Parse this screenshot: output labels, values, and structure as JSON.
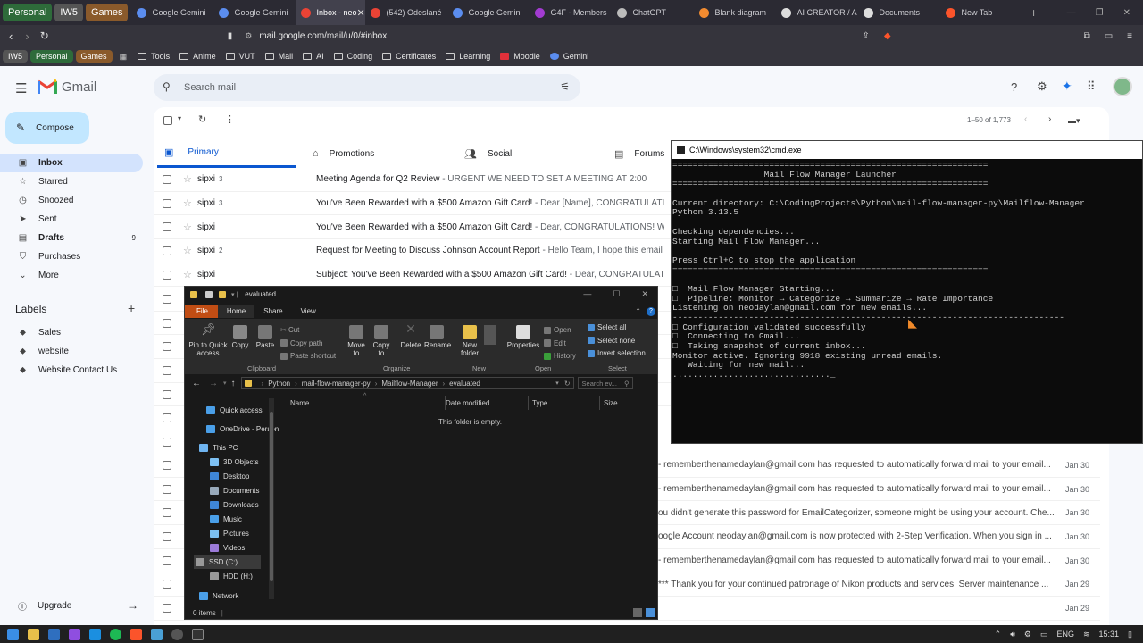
{
  "browser": {
    "tab_groups": [
      "Personal",
      "IW5",
      "Games"
    ],
    "tabs": [
      {
        "label": "Google Gemini",
        "color": "#5b8def"
      },
      {
        "label": "Google Gemini",
        "color": "#5b8def"
      },
      {
        "label": "Inbox - neo",
        "color": "#ea4335",
        "active": true
      },
      {
        "label": "(542) Odeslané",
        "color": "#ea4335"
      },
      {
        "label": "Google Gemini",
        "color": "#5b8def"
      },
      {
        "label": "G4F - Members",
        "color": "#a23bd1"
      },
      {
        "label": "ChatGPT",
        "color": "#bbbbbb"
      },
      {
        "label": "Blank diagram",
        "color": "#f28b30"
      },
      {
        "label": "AI CREATOR / A",
        "color": "#dddddd"
      },
      {
        "label": "Documents",
        "color": "#dddddd"
      },
      {
        "label": "New Tab",
        "color": "#fb542b"
      }
    ],
    "url": "mail.google.com/mail/u/0/#inbox",
    "bookmarks": {
      "groups": [
        "IW5",
        "Personal",
        "Games"
      ],
      "items": [
        "Tools",
        "Anime",
        "VUT",
        "Mail",
        "AI",
        "Coding",
        "Certificates",
        "Learning",
        "Moodle",
        "Gemini"
      ]
    }
  },
  "gmail": {
    "logo": "Gmail",
    "search_placeholder": "Search mail",
    "compose": "Compose",
    "nav": [
      {
        "label": "Inbox",
        "icon": "inbox-icon",
        "active": true,
        "bold": true,
        "count": ""
      },
      {
        "label": "Starred",
        "icon": "star-icon",
        "count": ""
      },
      {
        "label": "Snoozed",
        "icon": "clock-icon",
        "count": ""
      },
      {
        "label": "Sent",
        "icon": "send-icon",
        "count": ""
      },
      {
        "label": "Drafts",
        "icon": "draft-icon",
        "bold": true,
        "count": "9"
      },
      {
        "label": "Purchases",
        "icon": "purchases-icon",
        "count": ""
      },
      {
        "label": "More",
        "icon": "chevron-down-icon",
        "count": ""
      }
    ],
    "labels_title": "Labels",
    "labels": [
      "Sales",
      "website",
      "Website Contact Us"
    ],
    "upgrade": "Upgrade",
    "pagination": "1–50 of 1,773",
    "tabs": [
      "Primary",
      "Promotions",
      "Social",
      "Forums"
    ],
    "emails": [
      {
        "sender": "sipxi",
        "count": "3",
        "subject": "Meeting Agenda for Q2 Review",
        "preview": " - URGENT WE NEED TO SET A MEETING AT 2:00",
        "date": ""
      },
      {
        "sender": "sipxi",
        "count": "3",
        "subject": "You've Been Rewarded with a $500 Amazon Gift Card!",
        "preview": " - Dear [Name], CONGRATULATIONS! W",
        "date": ""
      },
      {
        "sender": "sipxi",
        "count": "",
        "subject": "You've Been Rewarded with a $500 Amazon Gift Card!",
        "preview": " - Dear, CONGRATULATIONS! We are th",
        "date": ""
      },
      {
        "sender": "sipxi",
        "count": "2",
        "subject": "Request for Meeting to Discuss Johnson Account Report",
        "preview": " - Hello Team, I hope this email finds y",
        "date": ""
      },
      {
        "sender": "sipxi",
        "count": "",
        "subject": "Subject: You've Been Rewarded with a $500 Amazon Gift Card!",
        "preview": " - Dear, CONGRATULATIONS! W",
        "date": ""
      }
    ],
    "lower_previews": [
      {
        "text": "- rememberthenamedaylan@gmail.com has requested to automatically forward mail to your email...",
        "date": "Jan 30"
      },
      {
        "text": "- rememberthenamedaylan@gmail.com has requested to automatically forward mail to your email...",
        "date": "Jan 30"
      },
      {
        "text": "ou didn't generate this password for EmailCategorizer, someone might be using your account. Che...",
        "date": "Jan 30"
      },
      {
        "text": "oogle Account neodaylan@gmail.com is now protected with 2-Step Verification. When you sign in ...",
        "date": "Jan 30"
      },
      {
        "text": "- rememberthenamedaylan@gmail.com has requested to automatically forward mail to your email...",
        "date": "Jan 30"
      },
      {
        "text": "*** Thank you for your continued patronage of Nikon products and services. Server maintenance ...",
        "date": "Jan 29"
      },
      {
        "text": "",
        "date": "Jan 29"
      }
    ]
  },
  "cmd": {
    "title": "C:\\Windows\\system32\\cmd.exe",
    "lines": [
      "==============================================================",
      "                  Mail Flow Manager Launcher",
      "==============================================================",
      "",
      "Current directory: C:\\CodingProjects\\Python\\mail-flow-manager-py\\Mailflow-Manager",
      "Python 3.13.5",
      "",
      "Checking dependencies...",
      "Starting Mail Flow Manager...",
      "",
      "Press Ctrl+C to stop the application",
      "==============================================================",
      "",
      "□  Mail Flow Manager Starting...",
      "□  Pipeline: Monitor → Categorize → Summarize → Rate Importance",
      "Listening on neodaylan@gmail.com for new emails...",
      "-----------------------------------------------------------------------------",
      "□ Configuration validated successfully",
      "□  Connecting to Gmail...",
      "□  Taking snapshot of current inbox...",
      "Monitor active. Ignoring 9918 existing unread emails.",
      "   Waiting for new mail...",
      "..............................._"
    ]
  },
  "explorer": {
    "title": "evaluated",
    "menu": [
      "File",
      "Home",
      "Share",
      "View"
    ],
    "ribbon": {
      "pin": "Pin to Quick access",
      "copy": "Copy",
      "paste": "Paste",
      "cut": "Cut",
      "copy_path": "Copy path",
      "paste_shortcut": "Paste shortcut",
      "move_to": "Move to",
      "copy_to": "Copy to",
      "delete": "Delete",
      "rename": "Rename",
      "new_folder": "New folder",
      "properties": "Properties",
      "open": "Open",
      "edit": "Edit",
      "history": "History",
      "select_all": "Select all",
      "select_none": "Select none",
      "invert_selection": "Invert selection",
      "groups": [
        "Clipboard",
        "Organize",
        "New",
        "Open",
        "Select"
      ]
    },
    "path": [
      "Python",
      "mail-flow-manager-py",
      "Mailflow-Manager",
      "evaluated"
    ],
    "search_placeholder": "Search ev...",
    "columns": [
      "Name",
      "Date modified",
      "Type",
      "Size"
    ],
    "empty_message": "This folder is empty.",
    "tree": [
      {
        "label": "Quick access",
        "color": "#4a9fe8"
      },
      {
        "label": "OneDrive - Person",
        "color": "#4a9fe8"
      },
      {
        "label": "This PC",
        "color": "#6fb4f0"
      },
      {
        "label": "3D Objects",
        "color": "#7dc0f2"
      },
      {
        "label": "Desktop",
        "color": "#3f86d6"
      },
      {
        "label": "Documents",
        "color": "#9ab"
      },
      {
        "label": "Downloads",
        "color": "#3f86d6"
      },
      {
        "label": "Music",
        "color": "#4a9fe8"
      },
      {
        "label": "Pictures",
        "color": "#7cbfef"
      },
      {
        "label": "Videos",
        "color": "#9b7ad8"
      },
      {
        "label": "SSD (C:)",
        "color": "#999"
      },
      {
        "label": "HDD (H:)",
        "color": "#999"
      },
      {
        "label": "Network",
        "color": "#4a9fe8"
      }
    ],
    "status": "0 items"
  },
  "taskbar": {
    "lang": "ENG",
    "time": "15:31"
  }
}
